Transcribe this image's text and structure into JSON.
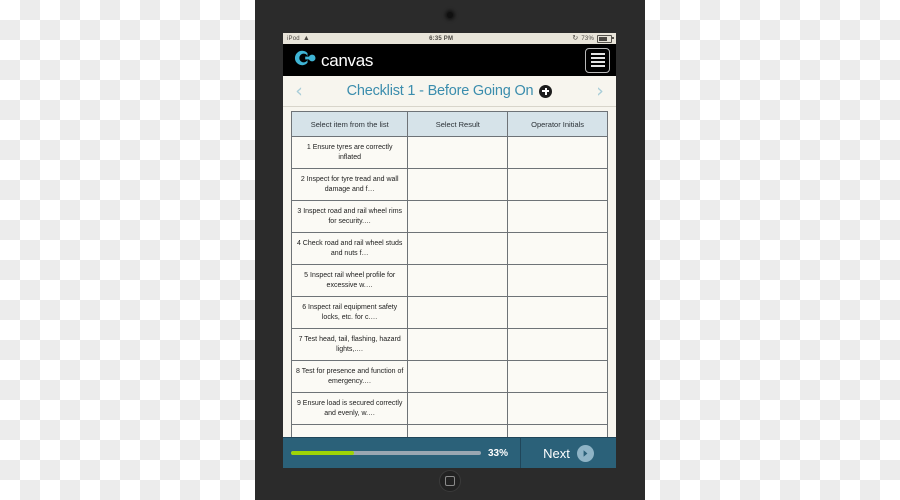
{
  "device": {
    "type": "tablet",
    "camera": "front-camera",
    "home_button": "home-button"
  },
  "status_bar": {
    "carrier": "iPod",
    "wifi_glyph": "▲",
    "time": "6:35 PM",
    "lock_glyph": "↻",
    "battery_text": "73%"
  },
  "app_bar": {
    "brand": "canvas",
    "menu_label": "menu"
  },
  "title_bar": {
    "prev_glyph": "‹",
    "next_glyph": "›",
    "title": "Checklist 1 - Before Going On",
    "add_label": "+"
  },
  "table": {
    "headers": [
      "Select item from the list",
      "Select Result",
      "Operator Initials"
    ],
    "rows": [
      {
        "item": "1 Ensure tyres are correctly inflated",
        "result": "",
        "initials": ""
      },
      {
        "item": "2 Inspect for tyre tread and wall damage and f…",
        "result": "",
        "initials": ""
      },
      {
        "item": "3 Inspect road and rail wheel rims for security.…",
        "result": "",
        "initials": ""
      },
      {
        "item": "4 Check road and rail wheel studs and nuts f…",
        "result": "",
        "initials": ""
      },
      {
        "item": "5 Inspect rail wheel profile for excessive w.…",
        "result": "",
        "initials": ""
      },
      {
        "item": "6 Inspect rail equipment safety locks, etc. for c.…",
        "result": "",
        "initials": ""
      },
      {
        "item": "7 Test head, tail, flashing, hazard lights,.…",
        "result": "",
        "initials": ""
      },
      {
        "item": "8 Test for presence and function of emergency.…",
        "result": "",
        "initials": ""
      },
      {
        "item": "9 Ensure load is secured correctly and evenly, w.…",
        "result": "",
        "initials": ""
      },
      {
        "item": "",
        "result": "",
        "initials": ""
      }
    ]
  },
  "footer": {
    "progress_percent": 33,
    "progress_label": "33%",
    "next_label": "Next"
  },
  "colors": {
    "brand_cyan": "#3fb4d4",
    "title_blue": "#3b8dad",
    "footer_blue": "#2b6179",
    "progress_green": "#9ed406",
    "header_cell": "#d6e3e9",
    "cell_bg": "#fbfaf5",
    "screen_bg": "#f7f5ee",
    "bezel": "#2b2b2b"
  }
}
